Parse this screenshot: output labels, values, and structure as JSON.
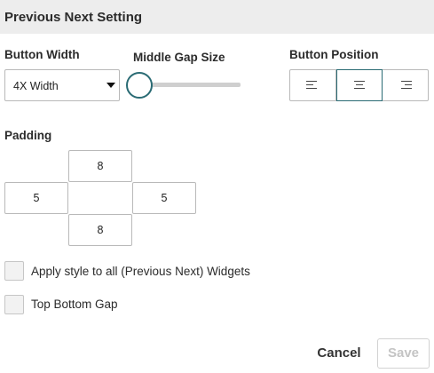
{
  "header": {
    "title": "Previous Next Setting"
  },
  "button_width": {
    "label": "Button Width",
    "selected": "4X Width"
  },
  "middle_gap": {
    "label": "Middle Gap Size",
    "value_fraction": 0
  },
  "button_position": {
    "label": "Button Position",
    "options": [
      "left",
      "center",
      "right"
    ],
    "selected": "center"
  },
  "padding": {
    "label": "Padding",
    "top": "8",
    "left": "5",
    "right": "5",
    "bottom": "8"
  },
  "options": {
    "apply_all": {
      "label": "Apply style to all (Previous Next) Widgets",
      "checked": false
    },
    "top_bottom_gap": {
      "label": "Top Bottom Gap",
      "checked": false
    }
  },
  "actions": {
    "cancel": "Cancel",
    "save": "Save"
  },
  "colors": {
    "accent": "#2a6b74",
    "header_bg": "#ededed",
    "disabled_text": "#c4c4c4"
  }
}
